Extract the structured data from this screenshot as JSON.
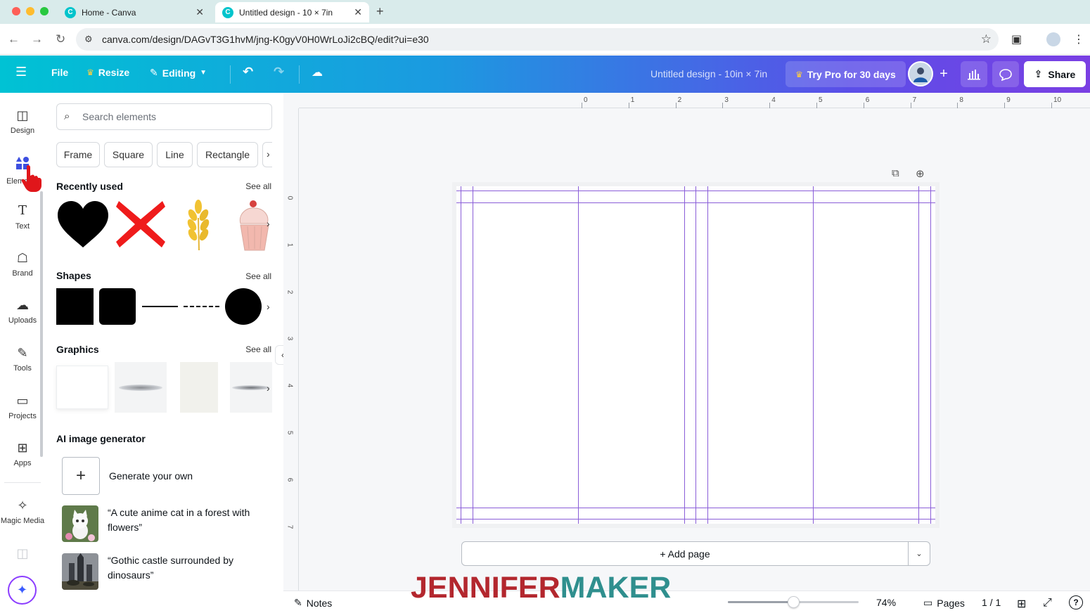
{
  "browser": {
    "tabs": [
      {
        "title": "Home - Canva",
        "active": false
      },
      {
        "title": "Untitled design - 10 × 7in",
        "active": true
      }
    ],
    "url": "canva.com/design/DAGvT3G1hvM/jng-K0gyV0H0WrLoJi2cBQ/edit?ui=e30"
  },
  "toolbar": {
    "file": "File",
    "resize": "Resize",
    "editing": "Editing",
    "design_title": "Untitled design - 10in × 7in",
    "try_pro": "Try Pro for 30 days",
    "share": "Share"
  },
  "rail": [
    {
      "label": "Design",
      "icon": "design-icon"
    },
    {
      "label": "Elements",
      "icon": "elements-icon"
    },
    {
      "label": "Text",
      "icon": "text-icon"
    },
    {
      "label": "Brand",
      "icon": "brand-icon"
    },
    {
      "label": "Uploads",
      "icon": "uploads-icon"
    },
    {
      "label": "Tools",
      "icon": "tools-icon"
    },
    {
      "label": "Projects",
      "icon": "projects-icon"
    },
    {
      "label": "Apps",
      "icon": "apps-icon"
    },
    {
      "label": "Magic Media",
      "icon": "magic-media-icon"
    }
  ],
  "panel": {
    "search_placeholder": "Search elements",
    "chips": [
      "Frame",
      "Square",
      "Line",
      "Rectangle"
    ],
    "recently_used": {
      "title": "Recently used",
      "see_all": "See all"
    },
    "shapes": {
      "title": "Shapes",
      "see_all": "See all"
    },
    "graphics": {
      "title": "Graphics",
      "see_all": "See all"
    },
    "ai": {
      "title": "AI image generator",
      "generate": "Generate your own",
      "prompts": [
        "“A cute anime cat in a forest with flowers”",
        "“Gothic castle surrounded by dinosaurs”"
      ]
    }
  },
  "ruler": {
    "h": [
      "0",
      "1",
      "2",
      "3",
      "4",
      "5",
      "6",
      "7",
      "8",
      "9",
      "10"
    ],
    "v": [
      "0",
      "1",
      "2",
      "3",
      "4",
      "5",
      "6",
      "7"
    ]
  },
  "canvas": {
    "add_page": "+ Add page"
  },
  "footer": {
    "notes": "Notes",
    "zoom_label": "74%",
    "zoom_value": 0.5,
    "pages": "Pages",
    "page_count": "1 / 1"
  },
  "watermark": {
    "part1": "JENNIFER",
    "part2": "MAKER"
  },
  "colors": {
    "accent": "#8b3dff",
    "toolbar_start": "#00c2d4",
    "toolbar_end": "#7a3fe3",
    "guide": "#8a5ed8",
    "watermark_red": "#b3272e",
    "watermark_teal": "#2f8f8e"
  }
}
